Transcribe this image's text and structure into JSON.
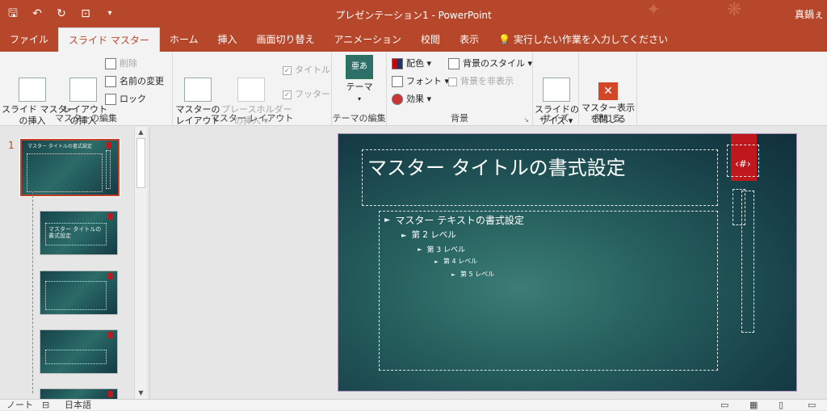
{
  "window": {
    "title": "プレゼンテーション1 - PowerPoint",
    "user": "真鍋ぇ"
  },
  "qat": {
    "save": "save-icon",
    "undo": "undo-icon",
    "redo": "redo-icon",
    "start": "slideshow-icon",
    "customize": "▾"
  },
  "tabs": [
    {
      "label": "ファイル"
    },
    {
      "label": "スライド マスター",
      "active": true
    },
    {
      "label": "ホーム"
    },
    {
      "label": "挿入"
    },
    {
      "label": "画面切り替え"
    },
    {
      "label": "アニメーション"
    },
    {
      "label": "校閲"
    },
    {
      "label": "表示"
    },
    {
      "label": "実行したい作業を入力してください"
    }
  ],
  "ribbon": {
    "master_edit": {
      "label": "マスターの編集",
      "insert_master": "スライド マスター\nの挿入",
      "insert_layout": "レイアウト\nの挿入",
      "delete": "削除",
      "rename": "名前の変更",
      "preserve": "ロック"
    },
    "master_layout": {
      "label": "マスター レイアウト",
      "layout": "マスターの\nレイアウト",
      "insert_placeholder": "プレースホルダー\nの挿入 ▾",
      "title_chk": "タイトル",
      "footer_chk": "フッター"
    },
    "edit_theme": {
      "label": "テーマの編集",
      "themes": "テーマ",
      "theme_glyph": "亜あ"
    },
    "background": {
      "label": "背景",
      "colors": "配色 ▾",
      "fonts": "フォント ▾",
      "effects": "効果 ▾",
      "bg_styles": "背景のスタイル ▾",
      "hide_bg": "背景を非表示"
    },
    "size": {
      "label": "サイズ",
      "slide_size": "スライドの\nサイズ ▾"
    },
    "close": {
      "label": "閉じる",
      "close_master": "マスター表示\nを閉じる"
    }
  },
  "thumbnails": {
    "first_num": "1",
    "master_title": "マスター タイトルの書式設定",
    "layout2_title": "マスター タイトルの\n書式設定"
  },
  "slide": {
    "title": "マスター タイトルの書式設定",
    "number": "‹#›",
    "levels": [
      "マスター テキストの書式設定",
      "第 2 レベル",
      "第 3 レベル",
      "第 4 レベル",
      "第 5 レベル"
    ]
  },
  "status": {
    "notes": "ノート",
    "lang": "日本語"
  },
  "colors": {
    "accent": "#b7472a",
    "slide_red": "#c0171c"
  }
}
